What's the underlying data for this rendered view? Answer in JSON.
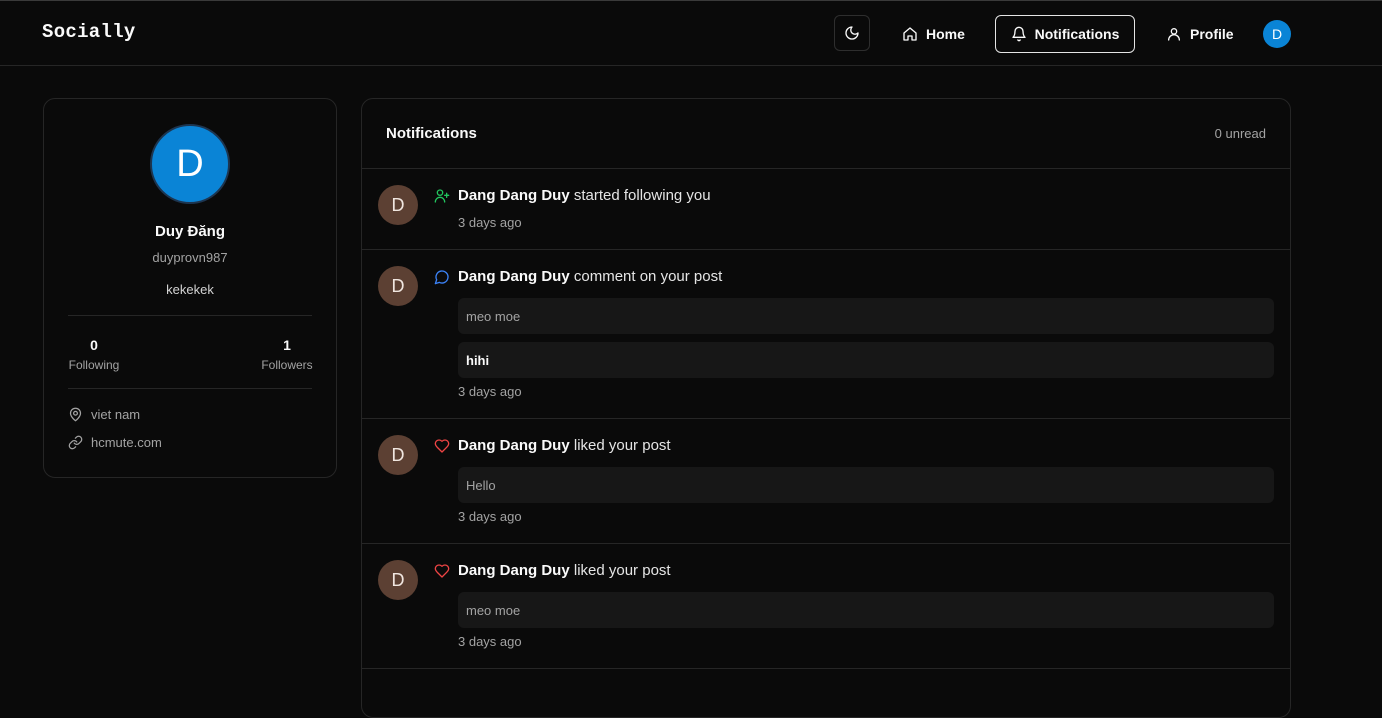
{
  "app": {
    "brand": "Socially"
  },
  "nav": {
    "home_label": "Home",
    "notifications_label": "Notifications",
    "profile_label": "Profile",
    "avatar_letter": "D"
  },
  "profile": {
    "avatar_letter": "D",
    "name": "Duy Đăng",
    "username": "duyprovn987",
    "bio": "kekekek",
    "following_count": "0",
    "following_label": "Following",
    "followers_count": "1",
    "followers_label": "Followers",
    "location": "viet nam",
    "website": "hcmute.com"
  },
  "notifications": {
    "title": "Notifications",
    "unread": "0 unread",
    "items": [
      {
        "avatar_letter": "D",
        "icon": "user-plus-icon",
        "user": "Dang Dang Duy",
        "action": "started following you",
        "time": "3 days ago"
      },
      {
        "avatar_letter": "D",
        "icon": "comment-icon",
        "user": "Dang Dang Duy",
        "action": "comment on your post",
        "post": "meo moe",
        "comment": "hihi",
        "time": "3 days ago"
      },
      {
        "avatar_letter": "D",
        "icon": "heart-icon",
        "user": "Dang Dang Duy",
        "action": "liked your post",
        "post": "Hello",
        "time": "3 days ago"
      },
      {
        "avatar_letter": "D",
        "icon": "heart-icon",
        "user": "Dang Dang Duy",
        "action": "liked your post",
        "post": "meo moe",
        "time": "3 days ago"
      }
    ]
  },
  "colors": {
    "background": "#0a0a0a",
    "border": "#262626",
    "avatar_blue": "#0a84d6",
    "avatar_brown": "#5c4033",
    "follow_green": "#22c55e",
    "comment_blue": "#3b82f6",
    "like_red": "#ef4444"
  }
}
